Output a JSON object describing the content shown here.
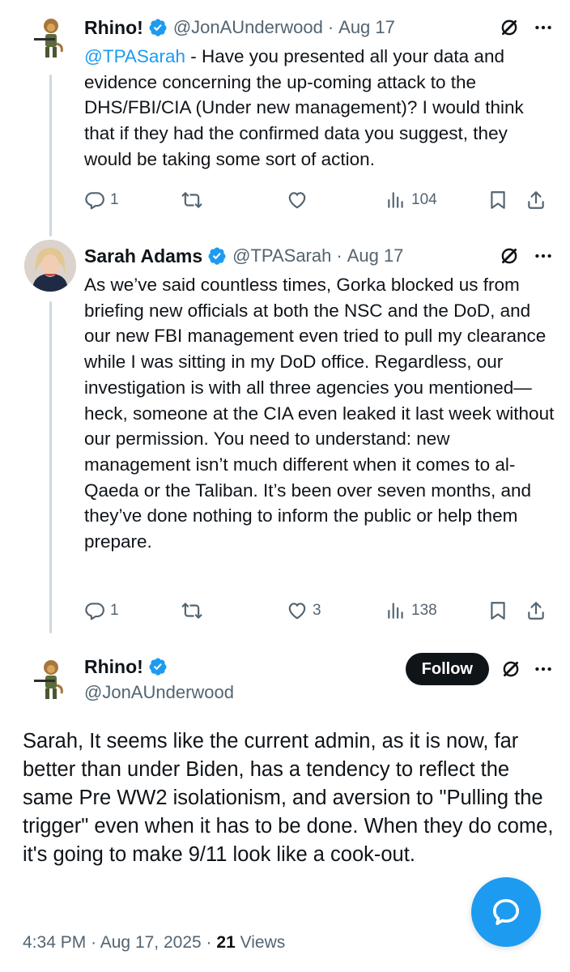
{
  "tweets": [
    {
      "name": "Rhino!",
      "handle": "@JonAUnderwood",
      "separator": "·",
      "date": "Aug 17",
      "mention": "@TPASarah",
      "text": " - Have you presented all your data and evidence concerning the up-coming attack to the DHS/FBI/CIA (Under new management)? I would think that if they had the confirmed data you suggest, they would be taking some sort of action.",
      "replies": "1",
      "retweets": "",
      "likes": "",
      "views": "104"
    },
    {
      "name": "Sarah Adams",
      "handle": "@TPASarah",
      "separator": "·",
      "date": "Aug 17",
      "text": "As we’ve said countless times, Gorka blocked us from briefing new officials at both the NSC and the DoD, and our new FBI management even tried to pull my clearance while I was sitting in my DoD office. Regardless, our investigation is with all three agencies you mentioned—heck, someone at the CIA even leaked it last week without our permission. You need to understand: new management isn’t much different when it comes to al-Qaeda or the Taliban. It’s been over seven months, and they’ve done nothing to inform the public or help them prepare.",
      "replies": "1",
      "retweets": "",
      "likes": "3",
      "views": "138"
    }
  ],
  "focus_tweet": {
    "name": "Rhino!",
    "handle": "@JonAUnderwood",
    "follow_label": "Follow",
    "text": "Sarah, It seems like the current admin, as it is now, far better than under Biden, has a tendency to reflect the same Pre WW2 isolationism, and aversion to \"Pulling the trigger\" even when it has to be done. When they do come, it's going to make 9/11 look like a cook-out.",
    "time": "4:34 PM",
    "date": "Aug 17, 2025",
    "separator": "·",
    "views_count": "21",
    "views_label": "Views"
  },
  "icons": {
    "verified": "verified-badge-icon",
    "grok": "grok-icon",
    "more": "more-icon",
    "reply": "reply-icon",
    "retweet": "retweet-icon",
    "like": "heart-icon",
    "views": "views-icon",
    "bookmark": "bookmark-icon",
    "share": "share-icon",
    "compose": "compose-reply-icon"
  },
  "colors": {
    "accent": "#1d9bf0",
    "text": "#0f1419",
    "secondary": "#536471",
    "thread_line": "#cfd9de",
    "follow_bg": "#0f1419"
  }
}
